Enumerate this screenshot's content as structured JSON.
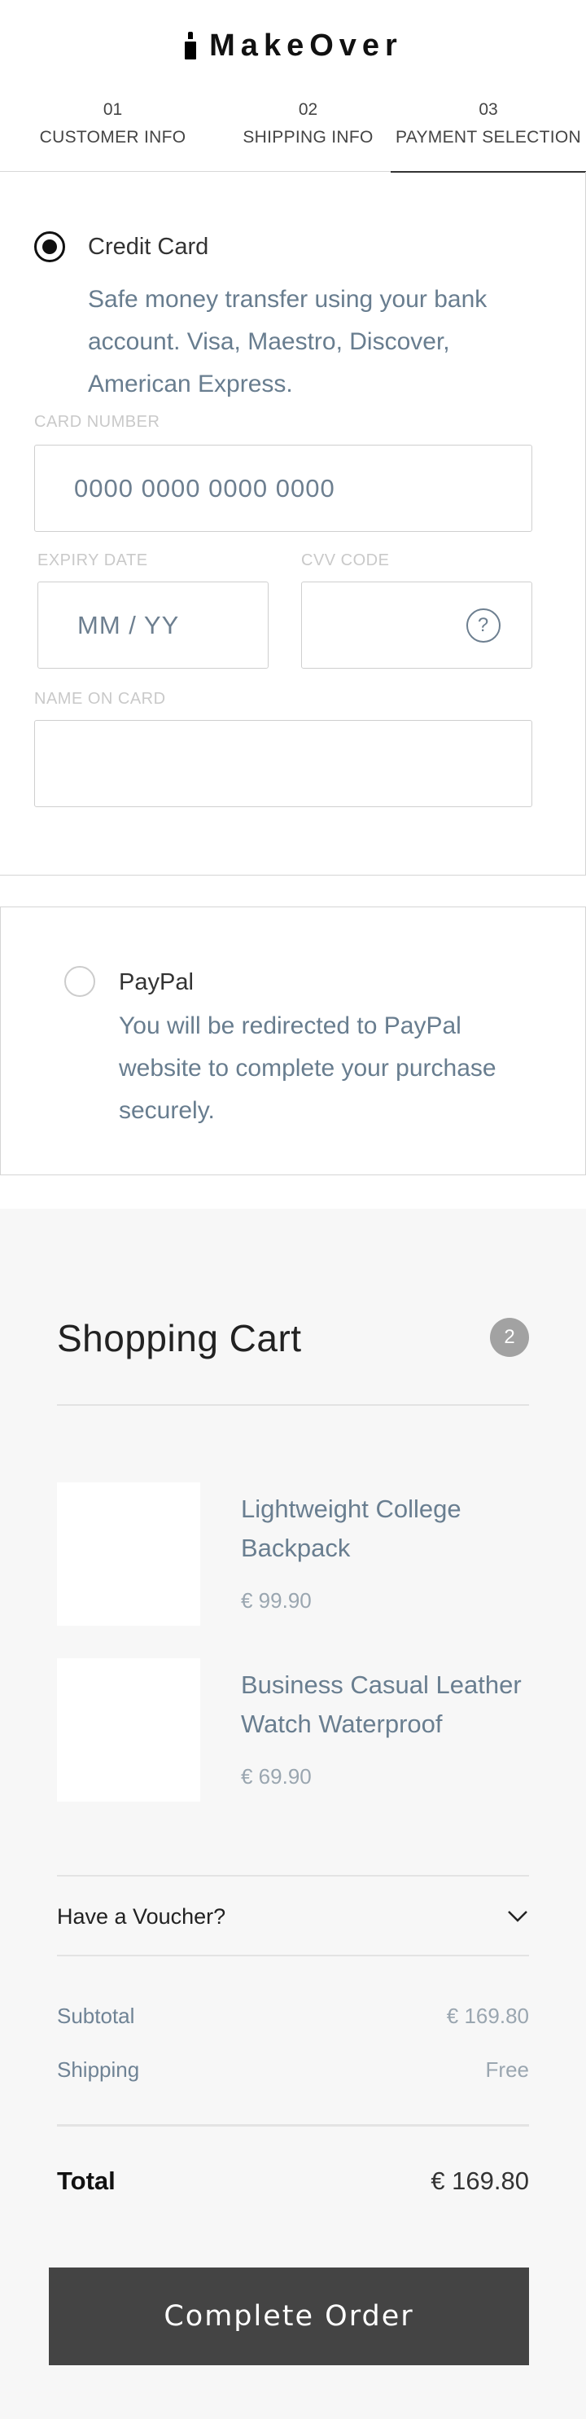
{
  "brand": {
    "name": "MakeOver",
    "logo_icon": "lipstick-icon"
  },
  "steps": [
    {
      "number": "01",
      "label": "CUSTOMER INFO",
      "active": false
    },
    {
      "number": "02",
      "label": "SHIPPING INFO",
      "active": false
    },
    {
      "number": "03",
      "label": "PAYMENT SELECTION",
      "active": true
    }
  ],
  "payment": {
    "credit_card": {
      "title": "Credit Card",
      "selected": true,
      "description": "Safe money transfer using your bank account. Visa, Maestro, Discover, American Express.",
      "card_number_label": "CARD NUMBER",
      "card_number_placeholder": "0000 0000 0000 0000",
      "expiry_label": "EXPIRY DATE",
      "expiry_placeholder": "MM / YY",
      "cvv_label": "CVV CODE",
      "cvv_help_icon": "question-circle-icon",
      "cvv_help_glyph": "?",
      "name_label": "NAME ON CARD"
    },
    "paypal": {
      "title": "PayPal",
      "selected": false,
      "description": "You will be redirected to PayPal website to complete your purchase securely."
    }
  },
  "cart": {
    "title": "Shopping Cart",
    "count": "2",
    "items": [
      {
        "name": "Lightweight College Backpack",
        "price": "€ 99.90"
      },
      {
        "name": "Business Casual Leather Watch Waterproof",
        "price": "€ 69.90"
      }
    ],
    "voucher_label": "Have a Voucher?",
    "subtotal_label": "Subtotal",
    "subtotal_value": "€ 169.80",
    "shipping_label": "Shipping",
    "shipping_value": "Free",
    "total_label": "Total",
    "total_value": "€ 169.80",
    "complete_button": "Complete Order"
  },
  "colors": {
    "button_bg": "#444444",
    "cart_bg": "#f7f7f7",
    "muted_text": "#687d8f",
    "badge": "#a2a2a2"
  }
}
